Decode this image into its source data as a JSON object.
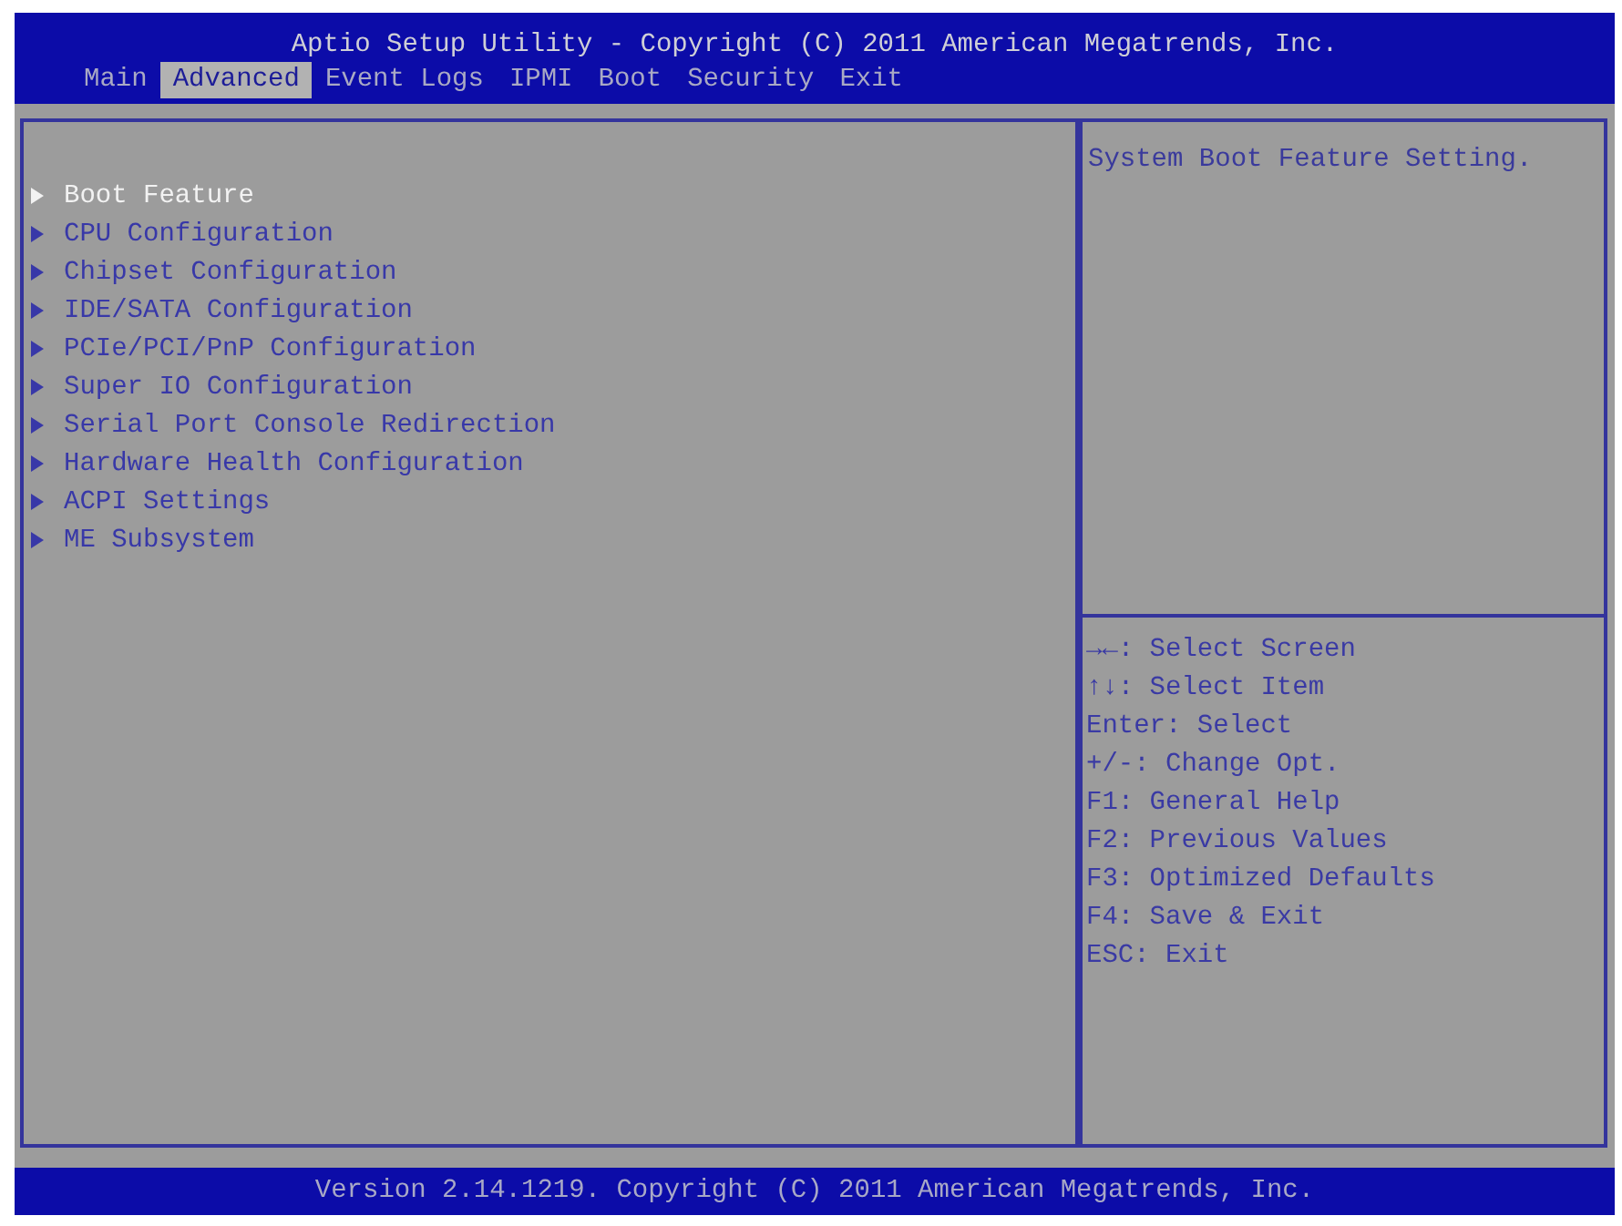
{
  "window": {
    "title": "Aptio Setup Utility - Copyright (C) 2011 American Megatrends, Inc."
  },
  "tabs": [
    {
      "label": "Main",
      "selected": false
    },
    {
      "label": "Advanced",
      "selected": true
    },
    {
      "label": "Event Logs",
      "selected": false
    },
    {
      "label": "IPMI",
      "selected": false
    },
    {
      "label": "Boot",
      "selected": false
    },
    {
      "label": "Security",
      "selected": false
    },
    {
      "label": "Exit",
      "selected": false
    }
  ],
  "menu": {
    "items": [
      {
        "label": "Boot Feature",
        "selected": true
      },
      {
        "label": "CPU Configuration",
        "selected": false
      },
      {
        "label": "Chipset Configuration",
        "selected": false
      },
      {
        "label": "IDE/SATA Configuration",
        "selected": false
      },
      {
        "label": "PCIe/PCI/PnP Configuration",
        "selected": false
      },
      {
        "label": "Super IO Configuration",
        "selected": false
      },
      {
        "label": "Serial Port Console Redirection",
        "selected": false
      },
      {
        "label": "Hardware Health Configuration",
        "selected": false
      },
      {
        "label": "ACPI Settings",
        "selected": false
      },
      {
        "label": "ME Subsystem",
        "selected": false
      }
    ]
  },
  "help": {
    "description": "System Boot Feature Setting.",
    "keys": [
      "→←: Select Screen",
      "↑↓: Select Item",
      "Enter: Select",
      "+/-: Change Opt.",
      "F1: General Help",
      "F2: Previous Values",
      "F3: Optimized Defaults",
      "F4: Save & Exit",
      "ESC: Exit"
    ]
  },
  "status_bar": "Version 2.14.1219. Copyright (C) 2011 American Megatrends, Inc."
}
